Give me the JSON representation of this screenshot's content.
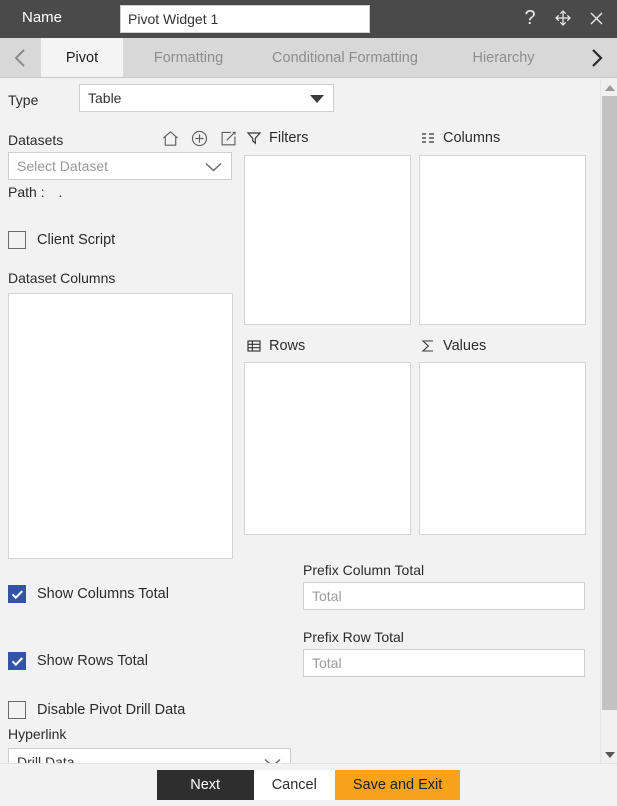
{
  "titlebar": {
    "name_label": "Name",
    "name_value": "Pivot Widget 1",
    "help_icon": "question-mark-icon",
    "move_icon": "move-arrows-icon",
    "close_icon": "close-icon"
  },
  "tabbar": {
    "prev_icon": "chevron-left-icon",
    "next_icon": "chevron-right-icon",
    "tabs": [
      {
        "label": "Pivot",
        "active": true
      },
      {
        "label": "Formatting",
        "active": false
      },
      {
        "label": "Conditional Formatting",
        "active": false
      },
      {
        "label": "Hierarchy",
        "active": false
      }
    ]
  },
  "main": {
    "type_label": "Type",
    "type_value": "Table",
    "datasets_label": "Datasets",
    "dataset_icons": [
      "home-icon",
      "add-circle-icon",
      "edit-icon"
    ],
    "dataset_placeholder": "Select Dataset",
    "path_label": "Path :",
    "path_value": ".",
    "client_script_label": "Client Script",
    "client_script_checked": false,
    "dataset_columns_label": "Dataset Columns",
    "show_columns_total_label": "Show Columns Total",
    "show_columns_total_checked": true,
    "show_rows_total_label": "Show Rows Total",
    "show_rows_total_checked": true,
    "disable_pivot_drill_label": "Disable Pivot Drill Data",
    "disable_pivot_drill_checked": false,
    "hyperlink_label": "Hyperlink",
    "hyperlink_value": "Drill Data",
    "prefix_column_total_label": "Prefix Column Total",
    "prefix_column_total_placeholder": "Total",
    "prefix_row_total_label": "Prefix Row Total",
    "prefix_row_total_placeholder": "Total",
    "zones": [
      {
        "title": "Filters",
        "icon": "funnel-icon"
      },
      {
        "title": "Columns",
        "icon": "columns-icon"
      },
      {
        "title": "Rows",
        "icon": "rows-grid-icon"
      },
      {
        "title": "Values",
        "icon": "sigma-icon"
      }
    ]
  },
  "scrollbar": {
    "up_icon": "scroll-up-arrow-icon",
    "down_icon": "scroll-down-arrow-icon"
  },
  "footer": {
    "next_label": "Next",
    "cancel_label": "Cancel",
    "save_label": "Save and Exit"
  },
  "colors": {
    "titlebar_bg": "#4a4a4a",
    "tabbar_bg": "#d8d8d8",
    "active_tab_bg": "#f4f4f4",
    "panel_bg": "#f2f2f2",
    "checkbox_blue": "#3453a4",
    "next_btn": "#2e2e2e",
    "save_btn": "#f6a31b"
  }
}
